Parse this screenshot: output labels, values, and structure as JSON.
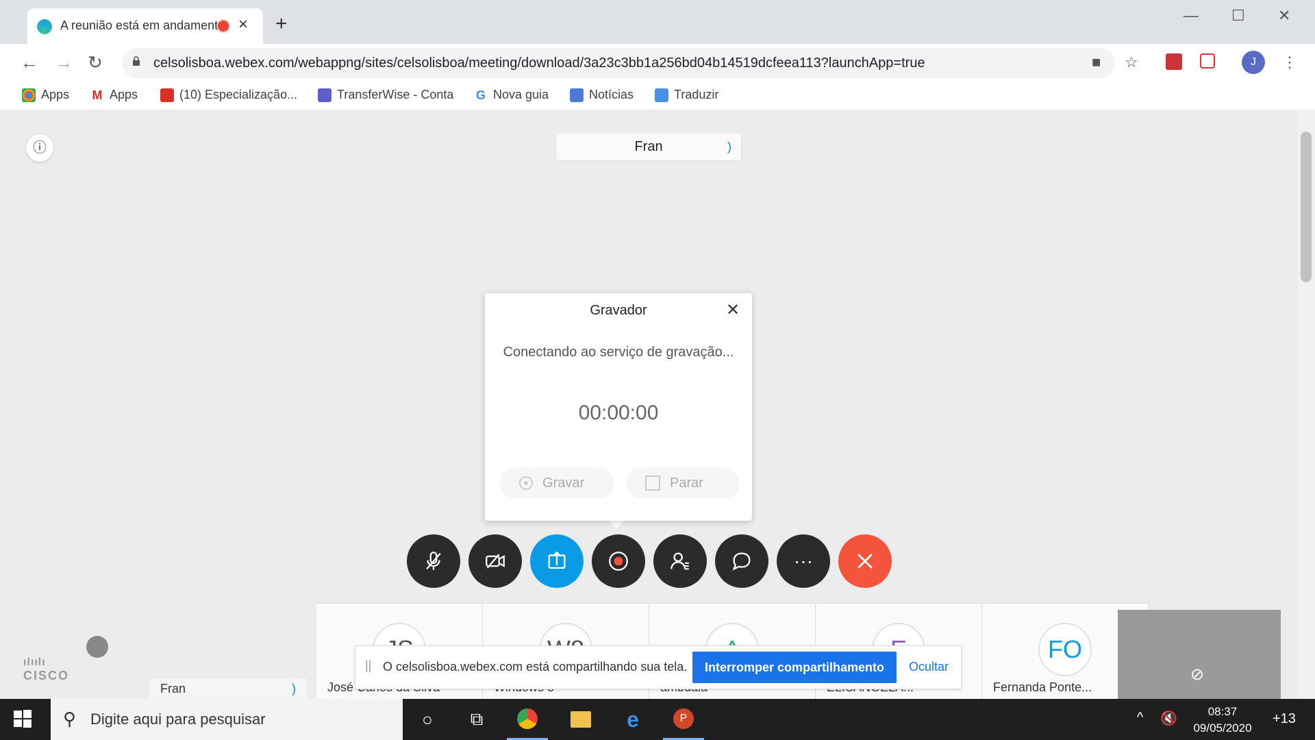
{
  "browser": {
    "tab_title": "A reunião está em andamento",
    "url": "celsolisboa.webex.com/webappng/sites/celsolisboa/meeting/download/3a23c3bb1a256bd04b14519dcfeea113?launchApp=true",
    "profile_initial": "J",
    "bookmarks": [
      {
        "label": "Apps",
        "icon": "apps-grid-icon"
      },
      {
        "label": "Apps",
        "icon": "gmail-icon"
      },
      {
        "label": "(10) Especialização...",
        "icon": "bookmark-icon"
      },
      {
        "label": "TransferWise - Conta",
        "icon": "transferwise-icon"
      },
      {
        "label": "Nova guia",
        "icon": "google-icon"
      },
      {
        "label": "Notícias",
        "icon": "news-icon"
      },
      {
        "label": "Traduzir",
        "icon": "translate-icon"
      }
    ]
  },
  "meeting": {
    "active_speaker": "Fran",
    "recorder": {
      "title": "Gravador",
      "status": "Conectando ao serviço de gravação...",
      "timer": "00:00:00",
      "record_label": "Gravar",
      "stop_label": "Parar"
    },
    "participants": [
      {
        "initials": "JS",
        "name": "José Carlos da Silva"
      },
      {
        "initials": "W8",
        "name": "Windows 8"
      },
      {
        "initials": "A",
        "name": "ambdaia"
      },
      {
        "initials": "E",
        "name": "ELISANGELA..."
      },
      {
        "initials": "FO",
        "name": "Fernanda Ponte..."
      }
    ],
    "local_name": "Fran",
    "brand": "CISCO",
    "share_banner": {
      "message": "O celsolisboa.webex.com está compartilhando sua tela.",
      "stop_label": "Interromper compartilhamento",
      "hide_label": "Ocultar"
    },
    "colors": {
      "share_button": "#1a73e8",
      "end_button": "#f4533c",
      "share_ctl": "#0a9be6"
    }
  },
  "taskbar": {
    "search_placeholder": "Digite aqui para pesquisar",
    "time": "08:37",
    "date": "09/05/2020",
    "notifications": "+13"
  }
}
